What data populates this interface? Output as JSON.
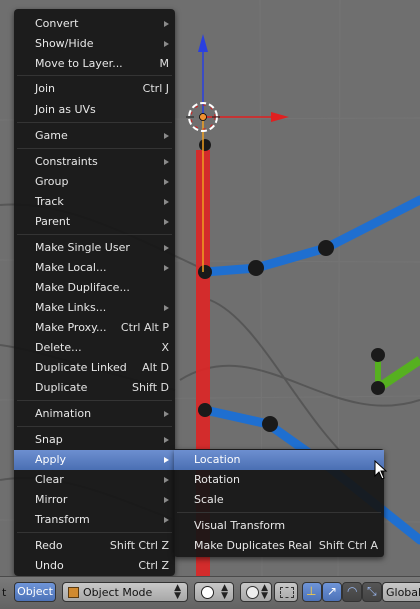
{
  "menu": {
    "items": [
      {
        "label": "Convert",
        "shortcut": "",
        "submenu": true
      },
      {
        "label": "Show/Hide",
        "shortcut": "",
        "submenu": true
      },
      {
        "label": "Move to Layer...",
        "shortcut": "M",
        "submenu": false
      },
      {
        "label": "Join",
        "shortcut": "Ctrl J",
        "submenu": false
      },
      {
        "label": "Join as UVs",
        "shortcut": "",
        "submenu": false
      },
      {
        "label": "Game",
        "shortcut": "",
        "submenu": true
      },
      {
        "label": "Constraints",
        "shortcut": "",
        "submenu": true
      },
      {
        "label": "Group",
        "shortcut": "",
        "submenu": true
      },
      {
        "label": "Track",
        "shortcut": "",
        "submenu": true
      },
      {
        "label": "Parent",
        "shortcut": "",
        "submenu": true
      },
      {
        "label": "Make Single User",
        "shortcut": "",
        "submenu": true
      },
      {
        "label": "Make Local...",
        "shortcut": "",
        "submenu": true
      },
      {
        "label": "Make Dupliface...",
        "shortcut": "",
        "submenu": false
      },
      {
        "label": "Make Links...",
        "shortcut": "",
        "submenu": true
      },
      {
        "label": "Make Proxy...",
        "shortcut": "Ctrl Alt P",
        "submenu": false
      },
      {
        "label": "Delete...",
        "shortcut": "X",
        "submenu": false
      },
      {
        "label": "Duplicate Linked",
        "shortcut": "Alt D",
        "submenu": false
      },
      {
        "label": "Duplicate",
        "shortcut": "Shift D",
        "submenu": false
      },
      {
        "label": "Animation",
        "shortcut": "",
        "submenu": true
      },
      {
        "label": "Snap",
        "shortcut": "",
        "submenu": true
      },
      {
        "label": "Apply",
        "shortcut": "",
        "submenu": true
      },
      {
        "label": "Clear",
        "shortcut": "",
        "submenu": true
      },
      {
        "label": "Mirror",
        "shortcut": "",
        "submenu": true
      },
      {
        "label": "Transform",
        "shortcut": "",
        "submenu": true
      },
      {
        "label": "Redo",
        "shortcut": "Shift Ctrl Z",
        "submenu": false
      },
      {
        "label": "Undo",
        "shortcut": "Ctrl Z",
        "submenu": false
      }
    ],
    "active_label": "Apply"
  },
  "submenu": {
    "items": [
      {
        "label": "Location",
        "shortcut": ""
      },
      {
        "label": "Rotation",
        "shortcut": ""
      },
      {
        "label": "Scale",
        "shortcut": ""
      },
      {
        "label": "Visual Transform",
        "shortcut": ""
      },
      {
        "label": "Make Duplicates Real",
        "shortcut": "Shift Ctrl A"
      }
    ],
    "active_label": "Location"
  },
  "header": {
    "prev_menu_fragment": "t",
    "object_menu_label": "Object",
    "mode_label": "Object Mode",
    "orientation_label": "Global"
  },
  "colors": {
    "menu_highlight": "#5a7fc4",
    "axis_x": "#e02020",
    "axis_y": "#2a40e0",
    "curve_blue": "#1e6fd0",
    "curve_green": "#50b020"
  }
}
